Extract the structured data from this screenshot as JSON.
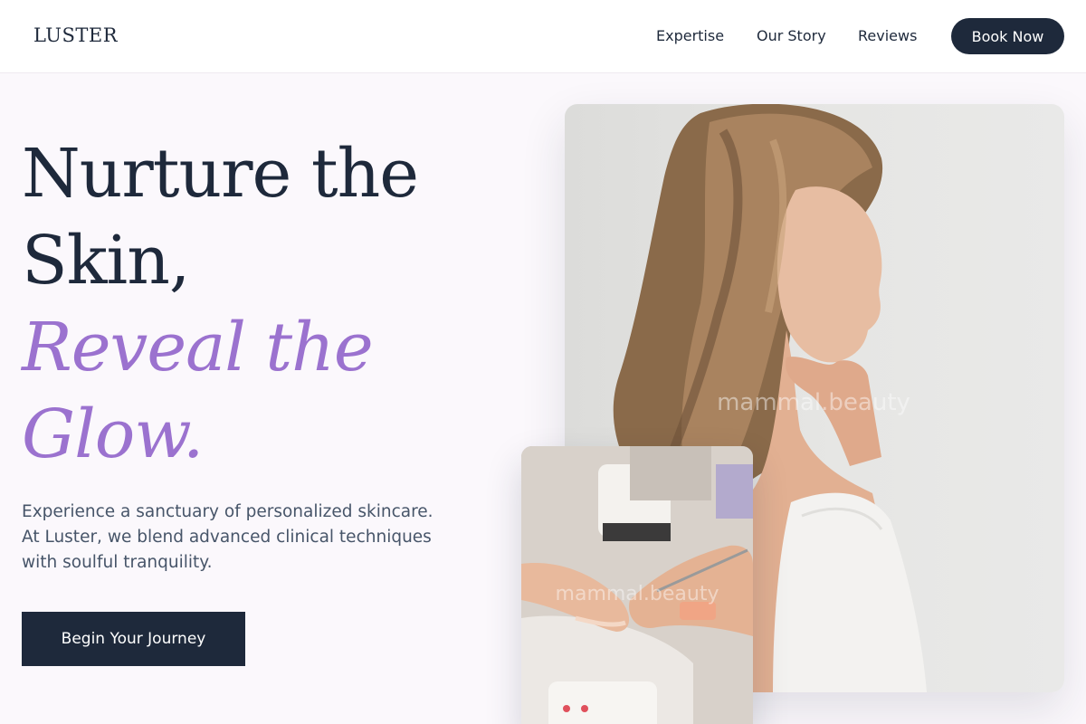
{
  "brand": {
    "logo": "LUSTER"
  },
  "nav": {
    "items": [
      "Expertise",
      "Our Story",
      "Reviews"
    ],
    "book_label": "Book Now"
  },
  "hero": {
    "headline_line1": "Nurture the",
    "headline_line2": "Skin,",
    "accent_line1": "Reveal the",
    "accent_line2": "Glow.",
    "intro": "Experience a sanctuary of personalized skincare. At Luster, we blend advanced clinical techniques with soulful tranquility.",
    "cta_label": "Begin Your Journey"
  },
  "images": {
    "main_watermark": "mammal.beauty",
    "secondary_watermark": "mammal.beauty"
  },
  "colors": {
    "primary": "#1e293b",
    "accent": "#9b72cf",
    "background": "#fbf8fc"
  }
}
